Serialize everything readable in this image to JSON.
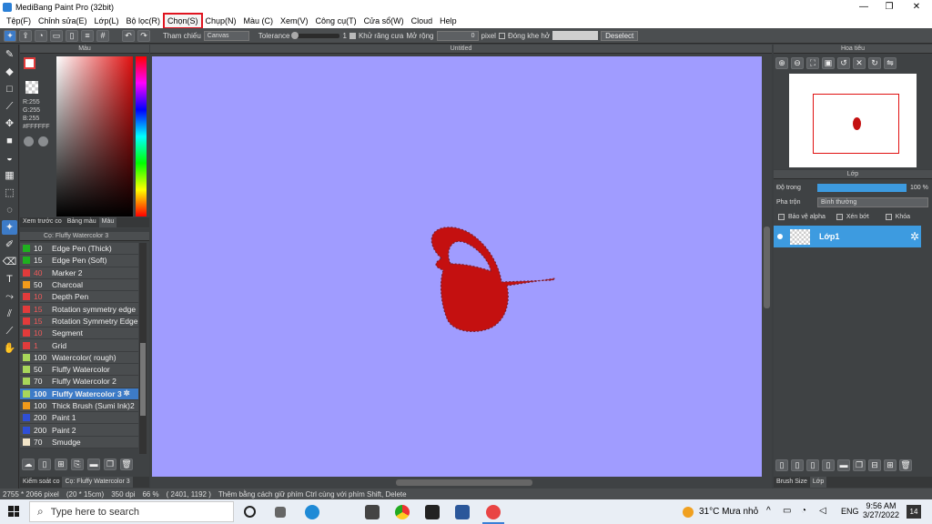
{
  "title": "MediBang Paint Pro (32bit)",
  "window_controls": [
    "—",
    "❐",
    "✕"
  ],
  "menu": [
    {
      "label": "Tệp(F)"
    },
    {
      "label": "Chỉnh sửa(E)"
    },
    {
      "label": "Lớp(L)"
    },
    {
      "label": "Bộ lọc(R)"
    },
    {
      "label": "Chọn(S)",
      "highlight": true
    },
    {
      "label": "Chụp(N)"
    },
    {
      "label": "Màu (C)"
    },
    {
      "label": "Xem(V)"
    },
    {
      "label": "Công cụ(T)"
    },
    {
      "label": "Cửa sổ(W)"
    },
    {
      "label": "Cloud"
    },
    {
      "label": "Help"
    }
  ],
  "toolbar": {
    "reference_label": "Tham chiếu",
    "reference_value": "Canvas",
    "tolerance_label": "Tolerance",
    "tolerance_value": "1",
    "antialias_label": "Khử răng cưa",
    "expand_label": "Mở rộng",
    "expand_value": "0",
    "expand_unit": "pixel",
    "close_gap_label": "Đóng khe hở",
    "deselect_label": "Deselect"
  },
  "color_panel": {
    "title": "Màu",
    "r": "R:255",
    "g": "G:255",
    "b": "B:255",
    "hex": "#FFFFFF",
    "tabs": [
      "Xem trước co",
      "Bảng màu",
      "Màu"
    ]
  },
  "brush_panel": {
    "title": "Cọ: Fluffy Watercolor 3",
    "brushes": [
      {
        "size": "10",
        "name": "Edge Pen (Thick)",
        "color": "#1fb01f"
      },
      {
        "size": "15",
        "name": "Edge Pen (Soft)",
        "color": "#1fb01f"
      },
      {
        "size": "40",
        "name": "Marker 2",
        "color": "#e23b3b"
      },
      {
        "size": "50",
        "name": "Charcoal",
        "color": "#f29a1a"
      },
      {
        "size": "10",
        "name": "Depth Pen",
        "color": "#e23b3b"
      },
      {
        "size": "15",
        "name": "Rotation symmetry edge",
        "color": "#e23b3b"
      },
      {
        "size": "15",
        "name": "Rotation Symmetry Edge",
        "color": "#e23b3b"
      },
      {
        "size": "10",
        "name": "Segment",
        "color": "#e23b3b"
      },
      {
        "size": "1",
        "name": "Grid",
        "color": "#e23b3b"
      },
      {
        "size": "100",
        "name": "Watercolor( rough)",
        "color": "#a8d65a"
      },
      {
        "size": "50",
        "name": "Fluffy Watercolor",
        "color": "#a8d65a"
      },
      {
        "size": "70",
        "name": "Fluffy Watercolor 2",
        "color": "#a8d65a"
      },
      {
        "size": "100",
        "name": "Fluffy Watercolor 3",
        "color": "#a8d65a",
        "selected": true
      },
      {
        "size": "100",
        "name": "Thick Brush (Sumi Ink)2",
        "color": "#f29a1a"
      },
      {
        "size": "200",
        "name": "Paint 1",
        "color": "#2f4fd6"
      },
      {
        "size": "200",
        "name": "Paint 2",
        "color": "#2f4fd6"
      },
      {
        "size": "70",
        "name": "Smudge",
        "color": "#f1e4c8"
      }
    ],
    "tabs": [
      "Kiểm soát co",
      "Cọ: Fluffy Watercolor 3"
    ]
  },
  "canvas": {
    "title": "Untitled",
    "background": "#a09cff"
  },
  "navigator": {
    "title": "Hoa tiêu"
  },
  "layer_panel": {
    "title": "Lớp",
    "opacity_label": "Độ trong",
    "opacity_value": "100 %",
    "blend_label": "Pha trộn",
    "blend_value": "Bình thường",
    "protect_alpha": "Bảo vệ alpha",
    "clipping": "Xén bớt",
    "lock": "Khóa",
    "layers": [
      {
        "name": "Lớp1"
      }
    ],
    "tabs": [
      "Brush Size",
      "Lớp"
    ]
  },
  "status": {
    "size": "2755 * 2066 pixel",
    "cm": "(20 * 15cm)",
    "dpi": "350 dpi",
    "zoom": "66 %",
    "coords": "( 2401, 1192 )",
    "hint": "Thêm bằng cách giữ phím Ctrl cùng với phím Shift, Delete"
  },
  "taskbar": {
    "search_placeholder": "Type here to search",
    "weather": "31°C  Mưa nhỏ",
    "lang": "ENG",
    "time": "9:56 AM",
    "date": "3/27/2022",
    "badge": "14"
  }
}
